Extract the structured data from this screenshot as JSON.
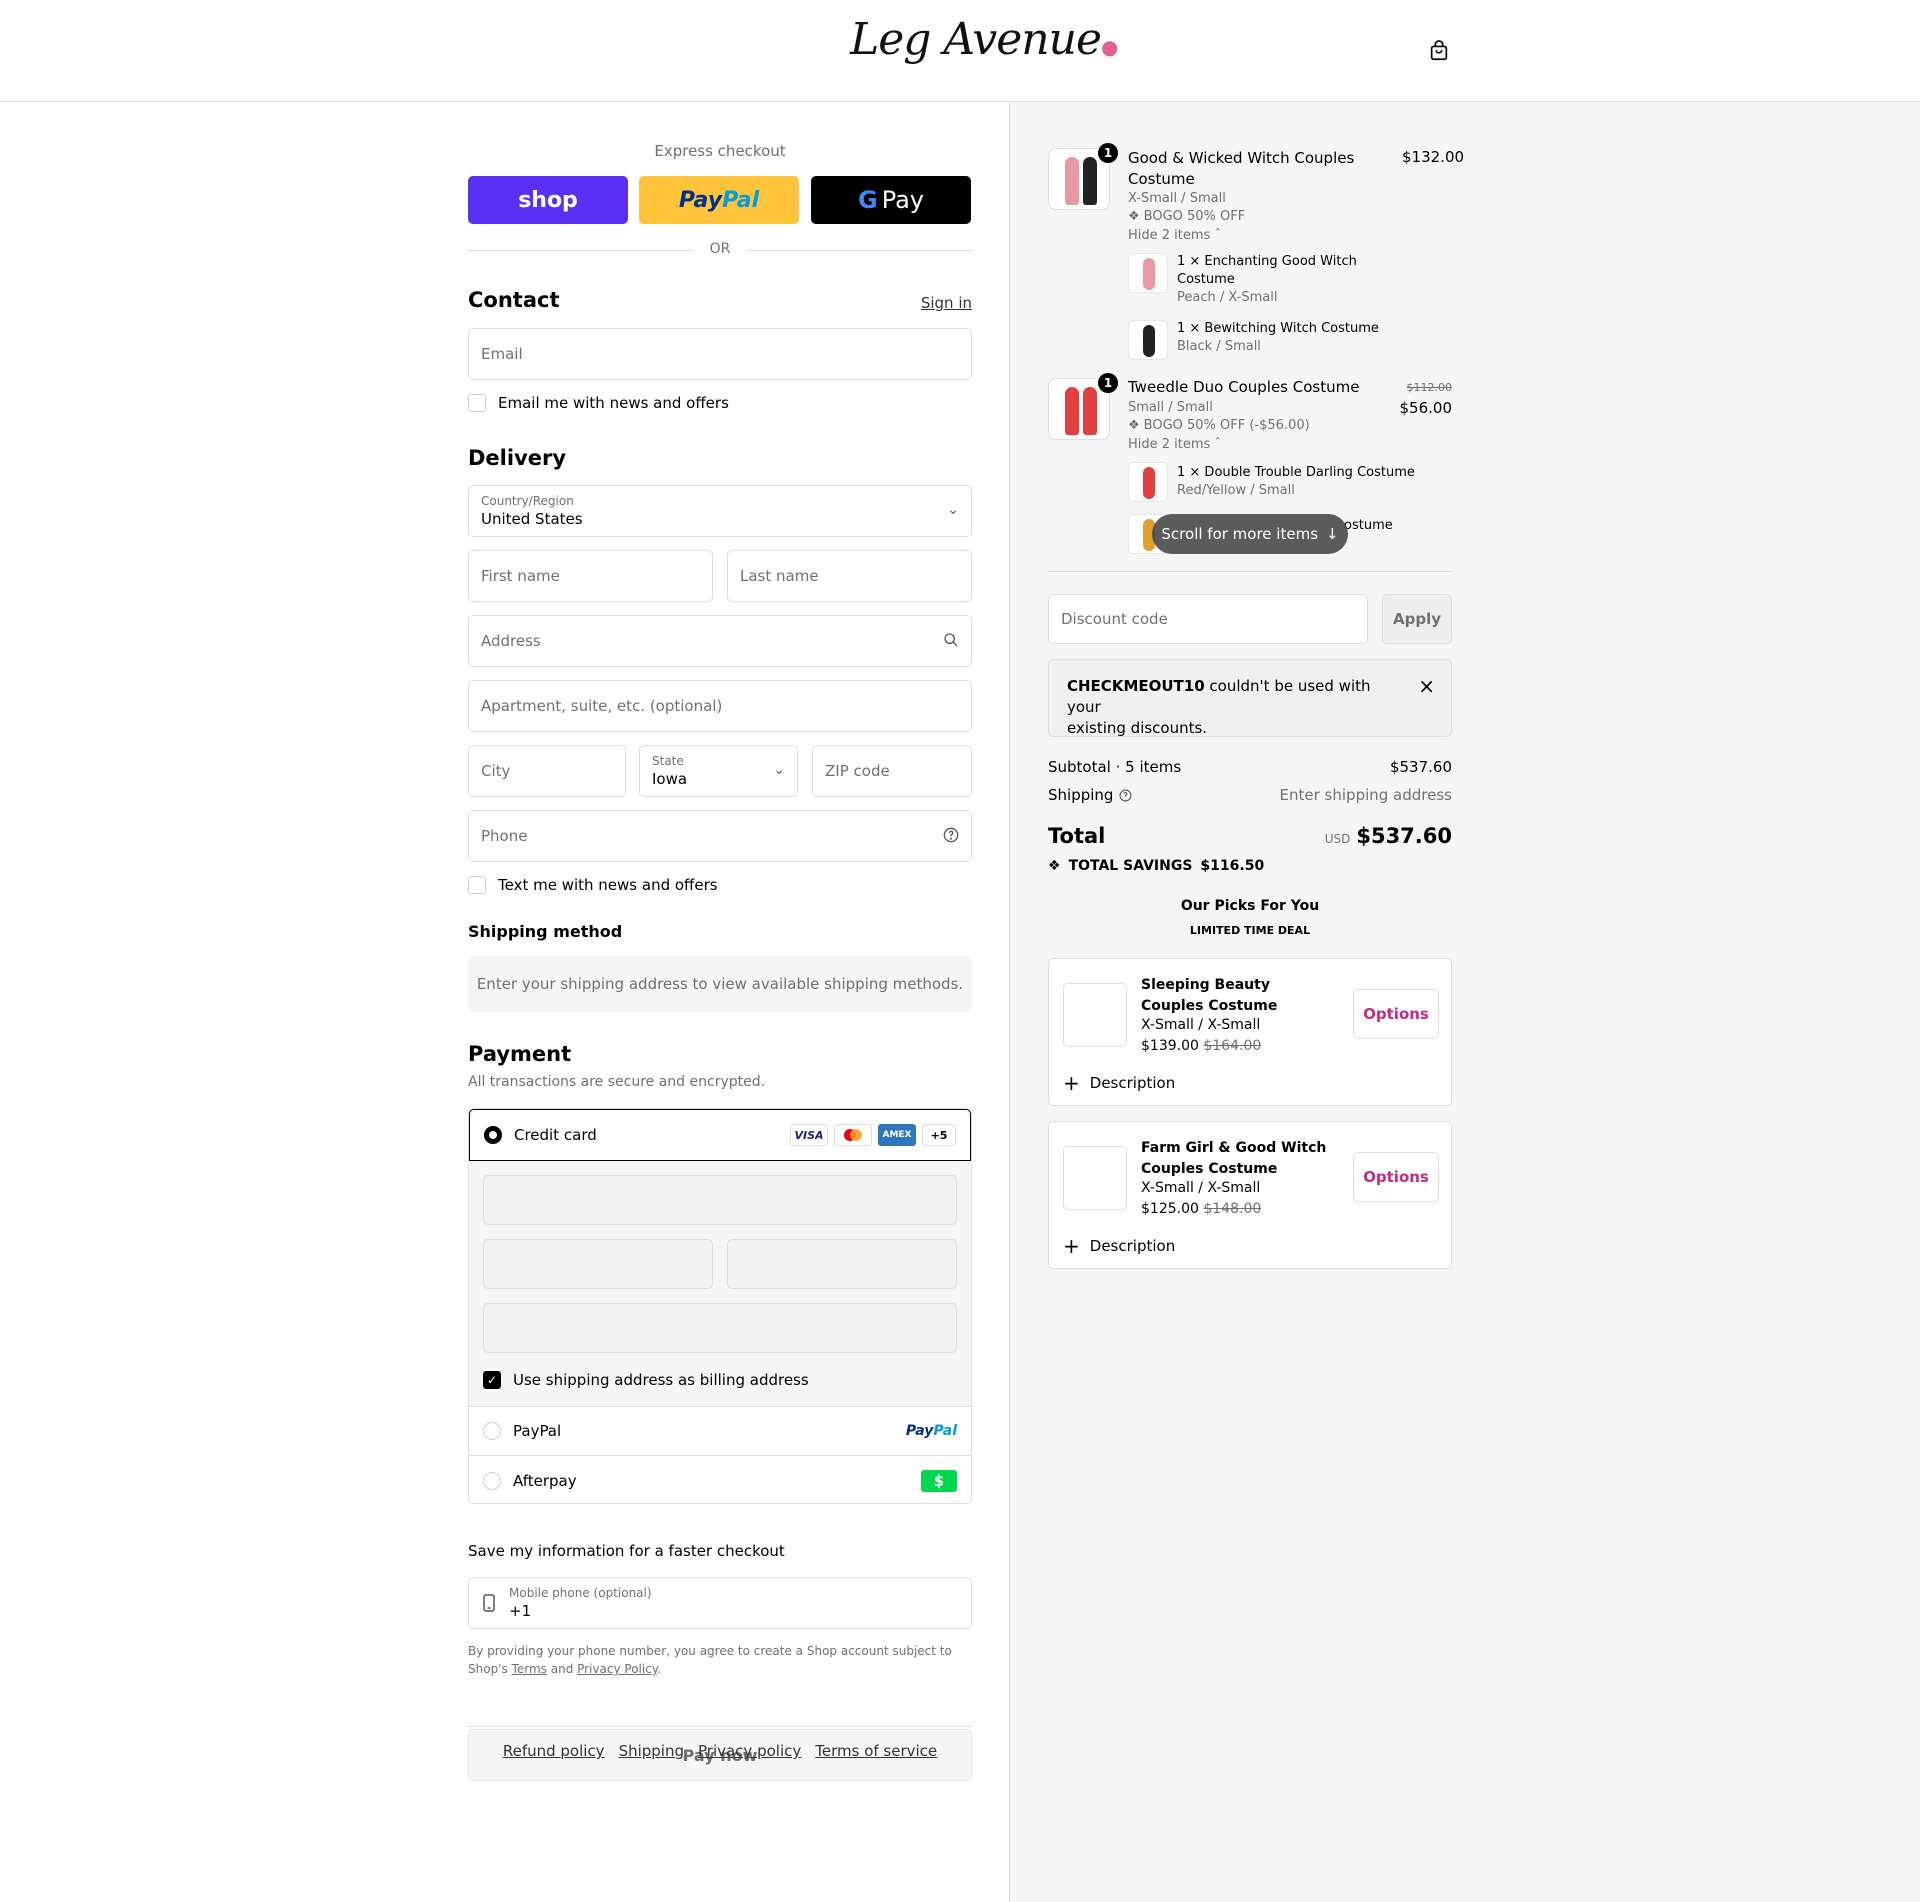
{
  "brand": {
    "logo_text": "Leg Avenue",
    "accent_color": "#e0609a"
  },
  "express": {
    "label": "Express checkout",
    "shop_label": "shop",
    "paypal_label_1": "Pay",
    "paypal_label_2": "Pal",
    "gpay_g": "G",
    "gpay_label": "Pay",
    "or": "OR"
  },
  "contact": {
    "title": "Contact",
    "sign_in": "Sign in",
    "email_placeholder": "Email",
    "email_news": "Email me with news and offers"
  },
  "delivery": {
    "title": "Delivery",
    "country_label": "Country/Region",
    "country_value": "United States",
    "first_name": "First name",
    "last_name": "Last name",
    "address": "Address",
    "apartment": "Apartment, suite, etc. (optional)",
    "city": "City",
    "state_label": "State",
    "state_value": "Iowa",
    "zip": "ZIP code",
    "phone": "Phone",
    "text_news": "Text me with news and offers"
  },
  "shipping_method": {
    "title": "Shipping method",
    "message": "Enter your shipping address to view available shipping methods."
  },
  "payment": {
    "title": "Payment",
    "subtitle": "All transactions are secure and encrypted.",
    "credit_card": "Credit card",
    "visa": "VISA",
    "amex": "AMEX",
    "more": "+5",
    "billing_same": "Use shipping address as billing address",
    "paypal": "PayPal",
    "paypal_logo_1": "Pay",
    "paypal_logo_2": "Pal",
    "afterpay": "Afterpay",
    "afterpay_logo": "$"
  },
  "save_info": {
    "title": "Save my information for a faster checkout",
    "mobile_label": "Mobile phone (optional)",
    "mobile_value": "+1",
    "legal_1": "By providing your phone number, you agree to create a Shop account subject to",
    "legal_2": "Shop's",
    "terms": "Terms",
    "and": "and",
    "privacy": "Privacy Policy",
    "period": "."
  },
  "pay_now": "Pay now",
  "footer": [
    "Refund policy",
    "Shipping",
    "Privacy policy",
    "Terms of service"
  ],
  "cart": {
    "items": [
      {
        "qty": "1",
        "title_line1": "Good & Wicked Witch Couples",
        "title_line2": "Costume",
        "variant": "X-Small / Small",
        "discount": "BOGO 50% OFF",
        "price": "$132.00",
        "toggle": "Hide 2 items",
        "sub": [
          {
            "name_line1": "1 × Enchanting Good Witch",
            "name_line2": "Costume",
            "variant": "Peach / X-Small"
          },
          {
            "name_line1": "1 × Bewitching Witch Costume",
            "variant": "Black / Small"
          }
        ]
      },
      {
        "qty": "1",
        "title": "Tweedle Duo Couples Costume",
        "variant": "Small / Small",
        "discount": "BOGO 50% OFF (-$56.00)",
        "old_price": "$112.00",
        "price": "$56.00",
        "toggle": "Hide 2 items",
        "sub": [
          {
            "name": "1 × Double Trouble Darling Costume",
            "variant": "Red/Yellow / Small"
          },
          {
            "name_tail": "ostume"
          }
        ]
      }
    ],
    "scroll_hint": "Scroll for more items"
  },
  "discount": {
    "placeholder": "Discount code",
    "apply": "Apply",
    "notice_code": "CHECKMEOUT10",
    "notice_rest": " couldn't be used with your",
    "notice_line2": "existing discounts."
  },
  "summary": {
    "subtotal_label": "Subtotal · 5 items",
    "subtotal_value": "$537.60",
    "shipping_label": "Shipping",
    "shipping_value": "Enter shipping address",
    "total_label": "Total",
    "currency": "USD",
    "total_value": "$537.60",
    "savings_label": "TOTAL SAVINGS",
    "savings_value": "$116.50"
  },
  "picks": {
    "title": "Our Picks For You",
    "subtitle": "LIMITED TIME DEAL",
    "items": [
      {
        "title": "Sleeping Beauty Couples Costume",
        "variant": "X-Small / X-Small",
        "price": "$139.00",
        "compare": "$164.00",
        "options": "Options",
        "description": "Description"
      },
      {
        "title": "Farm Girl & Good Witch Couples Costume",
        "variant": "X-Small / X-Small",
        "price": "$125.00",
        "compare": "$148.00",
        "options": "Options",
        "description": "Description"
      }
    ]
  }
}
